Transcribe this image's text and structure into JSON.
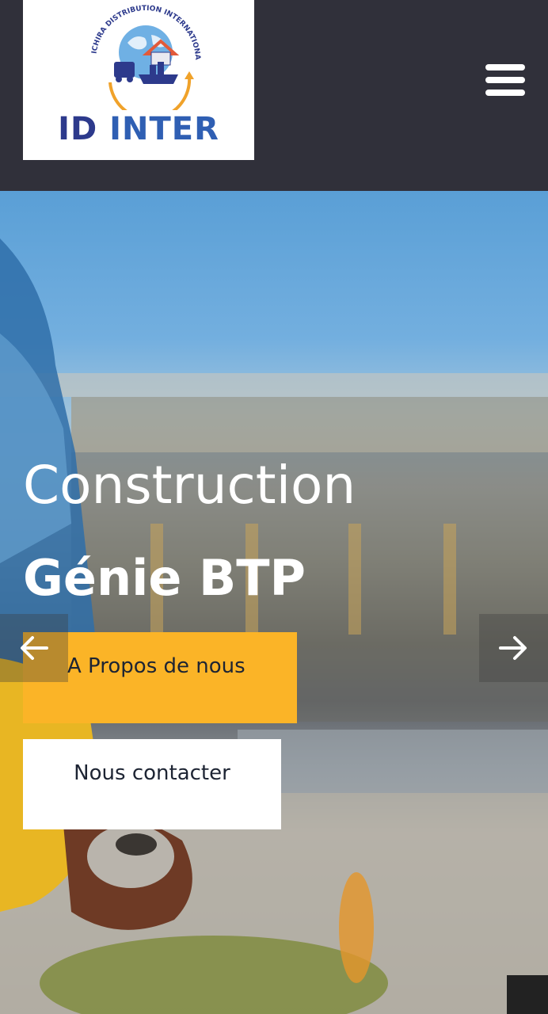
{
  "header": {
    "logo": {
      "emblem_text": "ICHIRA DISTRIBUTION INTERNATIONAL",
      "brand_part1": "ID",
      "brand_part2": "INTER"
    },
    "menu_icon": "hamburger-menu-icon"
  },
  "hero": {
    "title_light": "Construction",
    "title_bold": "Génie BTP",
    "about_button": "A Propos de nous",
    "contact_button": "Nous contacter",
    "prev_icon": "arrow-left-icon",
    "next_icon": "arrow-right-icon"
  },
  "colors": {
    "header_bg": "#30303a",
    "accent": "#fbb427",
    "brand_blue": "#2d3a8c"
  }
}
